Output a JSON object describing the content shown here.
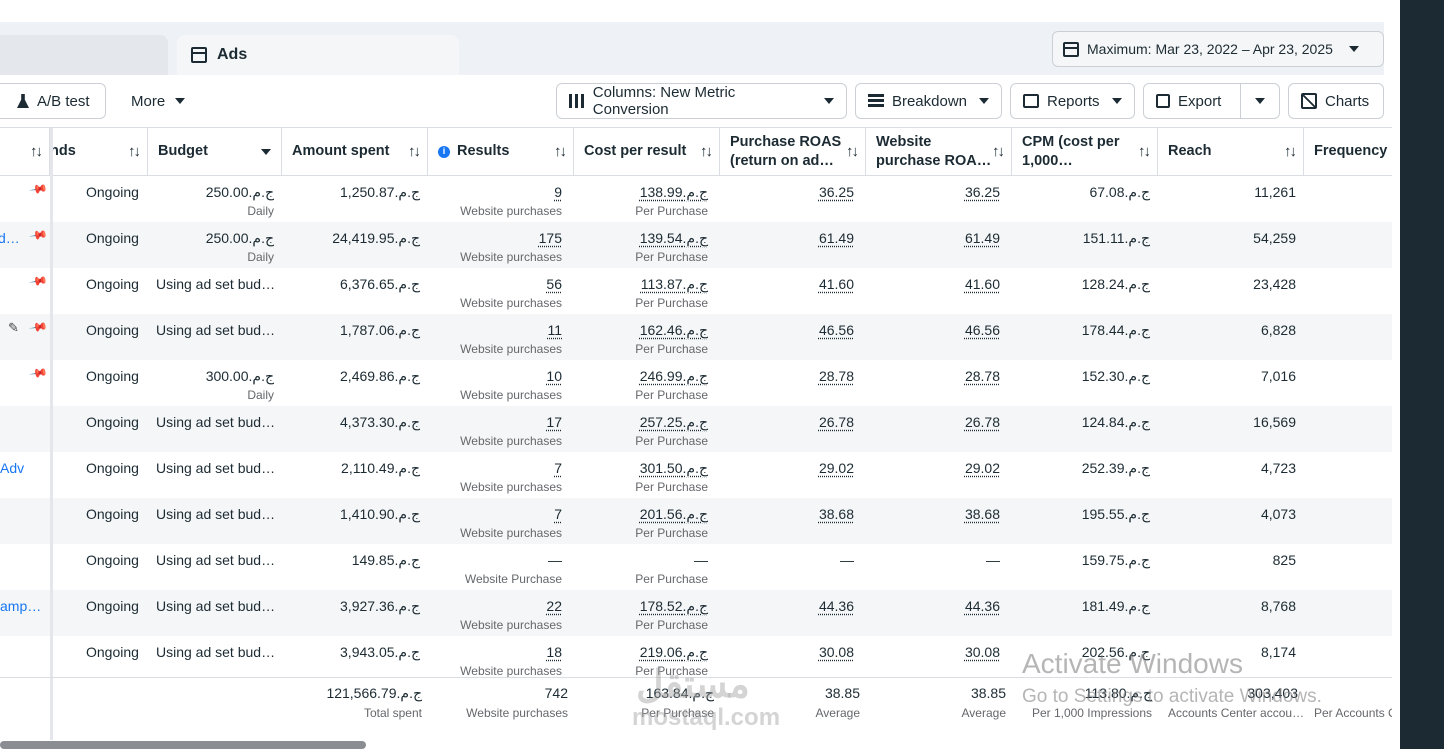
{
  "tabs": {
    "active": "Ads"
  },
  "date_range": {
    "label": "Maximum: Mar 23, 2022 – Apr 23, 2025"
  },
  "toolbar": {
    "ab_test": "A/B test",
    "more": "More",
    "columns": "Columns: New Metric Conversion",
    "breakdown": "Breakdown",
    "reports": "Reports",
    "export": "Export",
    "charts": "Charts"
  },
  "columns": {
    "ends": "nds",
    "budget": "Budget",
    "amount_spent": "Amount spent",
    "results": "Results",
    "cost_per_result": "Cost per result",
    "purchase_roas_1": "Purchase ROAS",
    "purchase_roas_2": "(return on ad…",
    "website_roas_1": "Website",
    "website_roas_2": "purchase ROA…",
    "cpm_1": "CPM (cost per",
    "cpm_2": "1,000…",
    "reach": "Reach",
    "frequency": "Frequency"
  },
  "rows": [
    {
      "name": "",
      "ends": "Ongoing",
      "budget": "ج.م.250.00",
      "budget_sub": "Daily",
      "spent": "ج.م.1,250.87",
      "results": "9",
      "results_sub": "Website purchases",
      "cpr": "ج.م.138.99",
      "cpr_sub": "Per Purchase",
      "roas": "36.25",
      "wroas": "36.25",
      "cpm": "ج.م.67.08",
      "reach": "11,261"
    },
    {
      "name": "d…",
      "ends": "Ongoing",
      "budget": "ج.م.250.00",
      "budget_sub": "Daily",
      "spent": "ج.م.24,419.95",
      "results": "175",
      "results_sub": "Website purchases",
      "cpr": "ج.م.139.54",
      "cpr_sub": "Per Purchase",
      "roas": "61.49",
      "wroas": "61.49",
      "cpm": "ج.م.151.11",
      "reach": "54,259"
    },
    {
      "name": "",
      "ends": "Ongoing",
      "budget": "Using ad set bud…",
      "budget_sub": "",
      "spent": "ج.م.6,376.65",
      "results": "56",
      "results_sub": "Website purchases",
      "cpr": "ج.م.113.87",
      "cpr_sub": "Per Purchase",
      "roas": "41.60",
      "wroas": "41.60",
      "cpm": "ج.م.128.24",
      "reach": "23,428"
    },
    {
      "name": "",
      "ends": "Ongoing",
      "budget": "Using ad set bud…",
      "budget_sub": "",
      "spent": "ج.م.1,787.06",
      "results": "11",
      "results_sub": "Website purchases",
      "cpr": "ج.م.162.46",
      "cpr_sub": "Per Purchase",
      "roas": "46.56",
      "wroas": "46.56",
      "cpm": "ج.م.178.44",
      "reach": "6,828"
    },
    {
      "name": "",
      "ends": "Ongoing",
      "budget": "ج.م.300.00",
      "budget_sub": "Daily",
      "spent": "ج.م.2,469.86",
      "results": "10",
      "results_sub": "Website purchases",
      "cpr": "ج.م.246.99",
      "cpr_sub": "Per Purchase",
      "roas": "28.78",
      "wroas": "28.78",
      "cpm": "ج.م.152.30",
      "reach": "7,016"
    },
    {
      "name": "",
      "ends": "Ongoing",
      "budget": "Using ad set bud…",
      "budget_sub": "",
      "spent": "ج.م.4,373.30",
      "results": "17",
      "results_sub": "Website purchases",
      "cpr": "ج.م.257.25",
      "cpr_sub": "Per Purchase",
      "roas": "26.78",
      "wroas": "26.78",
      "cpm": "ج.م.124.84",
      "reach": "16,569"
    },
    {
      "name": "Adv",
      "ends": "Ongoing",
      "budget": "Using ad set bud…",
      "budget_sub": "",
      "spent": "ج.م.2,110.49",
      "results": "7",
      "results_sub": "Website purchases",
      "cpr": "ج.م.301.50",
      "cpr_sub": "Per Purchase",
      "roas": "29.02",
      "wroas": "29.02",
      "cpm": "ج.م.252.39",
      "reach": "4,723"
    },
    {
      "name": "",
      "ends": "Ongoing",
      "budget": "Using ad set bud…",
      "budget_sub": "",
      "spent": "ج.م.1,410.90",
      "results": "7",
      "results_sub": "Website purchases",
      "cpr": "ج.م.201.56",
      "cpr_sub": "Per Purchase",
      "roas": "38.68",
      "wroas": "38.68",
      "cpm": "ج.م.195.55",
      "reach": "4,073"
    },
    {
      "name": "",
      "ends": "Ongoing",
      "budget": "Using ad set bud…",
      "budget_sub": "",
      "spent": "ج.م.149.85",
      "results": "—",
      "results_sub": "Website Purchase",
      "cpr": "—",
      "cpr_sub": "Per Purchase",
      "roas": "—",
      "wroas": "—",
      "cpm": "ج.م.159.75",
      "reach": "825"
    },
    {
      "name": "amp…",
      "ends": "Ongoing",
      "budget": "Using ad set bud…",
      "budget_sub": "",
      "spent": "ج.م.3,927.36",
      "results": "22",
      "results_sub": "Website purchases",
      "cpr": "ج.م.178.52",
      "cpr_sub": "Per Purchase",
      "roas": "44.36",
      "wroas": "44.36",
      "cpm": "ج.م.181.49",
      "reach": "8,768"
    },
    {
      "name": "",
      "ends": "Ongoing",
      "budget": "Using ad set bud…",
      "budget_sub": "",
      "spent": "ج.م.3,943.05",
      "results": "18",
      "results_sub": "Website purchases",
      "cpr": "ج.م.219.06",
      "cpr_sub": "Per Purchase",
      "roas": "30.08",
      "wroas": "30.08",
      "cpm": "ج.م.202.56",
      "reach": "8,174"
    }
  ],
  "totals": {
    "spent": "ج.م.121,566.79",
    "spent_sub": "Total spent",
    "results": "742",
    "results_sub": "Website purchases",
    "cpr": "ج.م.163.84",
    "cpr_sub": "Per Purchase",
    "roas": "38.85",
    "roas_sub": "Average",
    "wroas": "38.85",
    "wroas_sub": "Average",
    "cpm": "ج.م.113.80",
    "cpm_sub": "Per 1,000 Impressions",
    "reach": "303,403",
    "reach_sub": "Accounts Center accou…",
    "freq_sub": "Per Accounts C"
  },
  "overlay": {
    "watermark_ar": "مستقل",
    "watermark_en": "mostaql.com",
    "activate_title": "Activate Windows",
    "activate_sub": "Go to Settings to activate Windows."
  }
}
